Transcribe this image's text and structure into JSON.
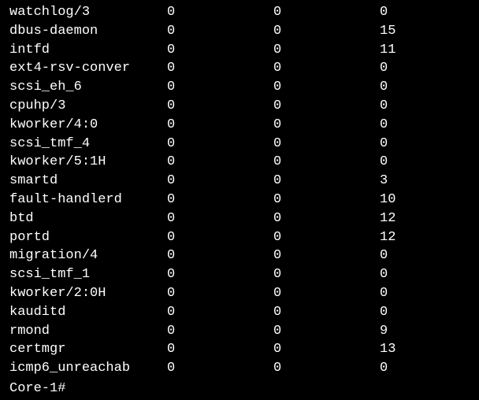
{
  "rows": [
    {
      "name": "watchlog/3",
      "c1": "0",
      "c2": "0",
      "c3": "0"
    },
    {
      "name": "dbus-daemon",
      "c1": "0",
      "c2": "0",
      "c3": "15"
    },
    {
      "name": "intfd",
      "c1": "0",
      "c2": "0",
      "c3": "11"
    },
    {
      "name": "ext4-rsv-conver",
      "c1": "0",
      "c2": "0",
      "c3": "0"
    },
    {
      "name": "scsi_eh_6",
      "c1": "0",
      "c2": "0",
      "c3": "0"
    },
    {
      "name": "cpuhp/3",
      "c1": "0",
      "c2": "0",
      "c3": "0"
    },
    {
      "name": "kworker/4:0",
      "c1": "0",
      "c2": "0",
      "c3": "0"
    },
    {
      "name": "scsi_tmf_4",
      "c1": "0",
      "c2": "0",
      "c3": "0"
    },
    {
      "name": "kworker/5:1H",
      "c1": "0",
      "c2": "0",
      "c3": "0"
    },
    {
      "name": "smartd",
      "c1": "0",
      "c2": "0",
      "c3": "3"
    },
    {
      "name": "fault-handlerd",
      "c1": "0",
      "c2": "0",
      "c3": "10"
    },
    {
      "name": "btd",
      "c1": "0",
      "c2": "0",
      "c3": "12"
    },
    {
      "name": "portd",
      "c1": "0",
      "c2": "0",
      "c3": "12"
    },
    {
      "name": "migration/4",
      "c1": "0",
      "c2": "0",
      "c3": "0"
    },
    {
      "name": "scsi_tmf_1",
      "c1": "0",
      "c2": "0",
      "c3": "0"
    },
    {
      "name": "kworker/2:0H",
      "c1": "0",
      "c2": "0",
      "c3": "0"
    },
    {
      "name": "kauditd",
      "c1": "0",
      "c2": "0",
      "c3": "0"
    },
    {
      "name": "rmond",
      "c1": "0",
      "c2": "0",
      "c3": "9"
    },
    {
      "name": "certmgr",
      "c1": "0",
      "c2": "0",
      "c3": "13"
    },
    {
      "name": "icmp6_unreachab",
      "c1": "0",
      "c2": "0",
      "c3": "0"
    }
  ],
  "prompt": "Core-1#"
}
